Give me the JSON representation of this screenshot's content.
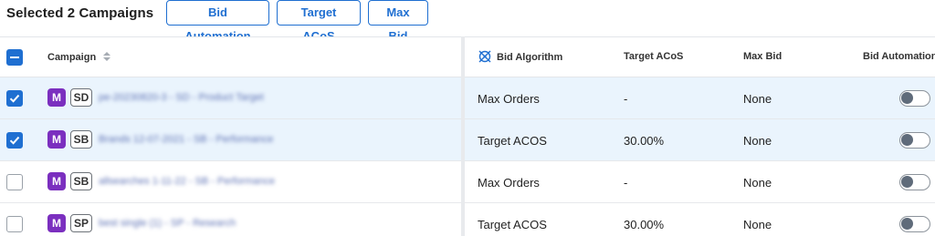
{
  "toolbar": {
    "selected_text": "Selected 2 Campaigns",
    "buttons": [
      "Bid Automation",
      "Target ACoS",
      "Max Bid"
    ]
  },
  "table": {
    "headers": {
      "campaign": "Campaign",
      "bid_algorithm": "Bid Algorithm",
      "target_acos": "Target ACoS",
      "max_bid": "Max Bid",
      "bid_automation": "Bid Automation"
    },
    "header_checkbox_checked": true,
    "rows": [
      {
        "checked": true,
        "badge_m": "M",
        "badge_type": "SD",
        "name_blurred": "pe-20230820-3 - SD - Product Target",
        "bid_algorithm": "Max Orders",
        "target_acos": "-",
        "max_bid": "None",
        "automation_on": false
      },
      {
        "checked": true,
        "badge_m": "M",
        "badge_type": "SB",
        "name_blurred": "Brands 12-07-2021 - SB - Performance",
        "bid_algorithm": "Target ACOS",
        "target_acos": "30.00%",
        "max_bid": "None",
        "automation_on": false
      },
      {
        "checked": false,
        "badge_m": "M",
        "badge_type": "SB",
        "name_blurred": "allsearches 1-11-22 - SB - Performance",
        "bid_algorithm": "Max Orders",
        "target_acos": "-",
        "max_bid": "None",
        "automation_on": false
      },
      {
        "checked": false,
        "badge_m": "M",
        "badge_type": "SP",
        "name_blurred": "best single (1) - SP - Research",
        "bid_algorithm": "Target ACOS",
        "target_acos": "30.00%",
        "max_bid": "None",
        "automation_on": false
      }
    ]
  },
  "colors": {
    "accent": "#1f6fd1",
    "badge_m": "#7b2fbf",
    "selected_row": "#eaf4fd"
  },
  "icons": {
    "sort": "sort-arrows-icon",
    "bid_algorithm": "crosshair-bid-icon"
  }
}
